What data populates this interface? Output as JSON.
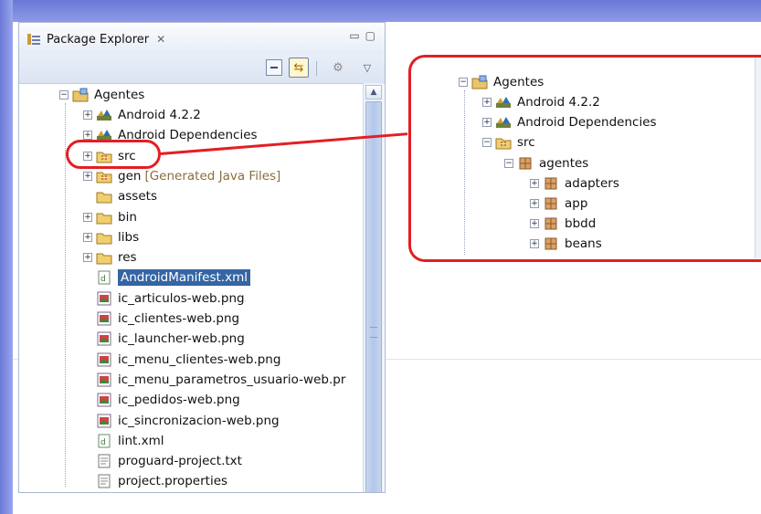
{
  "view": {
    "title": "Package Explorer",
    "close_glyph": "✕",
    "minimize_glyph": "▭",
    "maximize_glyph": "▢"
  },
  "toolbar": {
    "collapse_all": "collapse-all-icon",
    "link_with_editor_glyph": "⇆",
    "filter_glyph": "⚙",
    "view_menu_glyph": "▽"
  },
  "tree": {
    "project": "Agentes",
    "items": [
      {
        "label": "Android 4.2.2",
        "icon": "library-icon",
        "toggle": "+"
      },
      {
        "label": "Android Dependencies",
        "icon": "library-icon",
        "toggle": "+"
      },
      {
        "label": "src",
        "icon": "source-folder-icon",
        "toggle": "+"
      },
      {
        "label": "gen",
        "decoration": "[Generated Java Files]",
        "icon": "source-folder-icon",
        "toggle": "+"
      },
      {
        "label": "assets",
        "icon": "folder-icon",
        "toggle": ""
      },
      {
        "label": "bin",
        "icon": "folder-icon",
        "toggle": "+"
      },
      {
        "label": "libs",
        "icon": "folder-icon",
        "toggle": "+"
      },
      {
        "label": "res",
        "icon": "folder-icon",
        "toggle": "+"
      },
      {
        "label": "AndroidManifest.xml",
        "icon": "xml-file-icon",
        "toggle": "",
        "selected": true
      },
      {
        "label": "ic_articulos-web.png",
        "icon": "image-file-icon",
        "toggle": ""
      },
      {
        "label": "ic_clientes-web.png",
        "icon": "image-file-icon",
        "toggle": ""
      },
      {
        "label": "ic_launcher-web.png",
        "icon": "image-file-icon",
        "toggle": ""
      },
      {
        "label": "ic_menu_clientes-web.png",
        "icon": "image-file-icon",
        "toggle": ""
      },
      {
        "label": "ic_menu_parametros_usuario-web.pr",
        "icon": "image-file-icon",
        "toggle": ""
      },
      {
        "label": "ic_pedidos-web.png",
        "icon": "image-file-icon",
        "toggle": ""
      },
      {
        "label": "ic_sincronizacion-web.png",
        "icon": "image-file-icon",
        "toggle": ""
      },
      {
        "label": "lint.xml",
        "icon": "xml-file-icon",
        "toggle": ""
      },
      {
        "label": "proguard-project.txt",
        "icon": "text-file-icon",
        "toggle": ""
      },
      {
        "label": "project.properties",
        "icon": "text-file-icon",
        "toggle": ""
      }
    ]
  },
  "zoom": {
    "project": "Agentes",
    "items": [
      {
        "label": "Android 4.2.2",
        "icon": "library-icon",
        "toggle": "+",
        "level": 1
      },
      {
        "label": "Android Dependencies",
        "icon": "library-icon",
        "toggle": "+",
        "level": 1
      },
      {
        "label": "src",
        "icon": "source-folder-icon",
        "toggle": "−",
        "level": 1
      },
      {
        "label": "agentes",
        "icon": "package-icon",
        "toggle": "−",
        "level": 2
      },
      {
        "label": "adapters",
        "icon": "package-icon",
        "toggle": "+",
        "level": 3
      },
      {
        "label": "app",
        "icon": "package-icon",
        "toggle": "+",
        "level": 3
      },
      {
        "label": "bbdd",
        "icon": "package-icon",
        "toggle": "+",
        "level": 3
      },
      {
        "label": "beans",
        "icon": "package-icon",
        "toggle": "+",
        "level": 3
      }
    ]
  },
  "colors": {
    "callout": "#e31e24",
    "selection": "#3465a4",
    "decoration": "#8a6d3b"
  }
}
